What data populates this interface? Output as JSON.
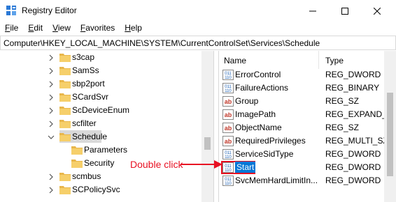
{
  "window": {
    "title": "Registry Editor",
    "minimize_symbol": "—",
    "maximize_symbol": "☐",
    "close_symbol": "✕"
  },
  "menu": [
    {
      "label": "File"
    },
    {
      "label": "Edit"
    },
    {
      "label": "View"
    },
    {
      "label": "Favorites"
    },
    {
      "label": "Help"
    }
  ],
  "address": {
    "path": "Computer\\HKEY_LOCAL_MACHINE\\SYSTEM\\CurrentControlSet\\Services\\Schedule"
  },
  "tree": {
    "items": [
      {
        "label": "s3cap",
        "expander": "collapsed",
        "level": 1
      },
      {
        "label": "SamSs",
        "expander": "collapsed",
        "level": 1
      },
      {
        "label": "sbp2port",
        "expander": "collapsed",
        "level": 1
      },
      {
        "label": "SCardSvr",
        "expander": "collapsed",
        "level": 1
      },
      {
        "label": "ScDeviceEnum",
        "expander": "collapsed",
        "level": 1
      },
      {
        "label": "scfilter",
        "expander": "collapsed",
        "level": 1
      },
      {
        "label": "Schedule",
        "expander": "expanded",
        "level": 1,
        "selected": true
      },
      {
        "label": "Parameters",
        "expander": "none",
        "level": 2
      },
      {
        "label": "Security",
        "expander": "none",
        "level": 2
      },
      {
        "label": "scmbus",
        "expander": "collapsed",
        "level": 1
      },
      {
        "label": "SCPolicySvc",
        "expander": "collapsed",
        "level": 1
      }
    ]
  },
  "list": {
    "header_name": "Name",
    "header_type": "Type",
    "rows": [
      {
        "name": "ErrorControl",
        "type": "REG_DWORD",
        "icon": "binary-value-icon"
      },
      {
        "name": "FailureActions",
        "type": "REG_BINARY",
        "icon": "binary-value-icon"
      },
      {
        "name": "Group",
        "type": "REG_SZ",
        "icon": "string-value-icon"
      },
      {
        "name": "ImagePath",
        "type": "REG_EXPAND_S",
        "icon": "string-value-icon"
      },
      {
        "name": "ObjectName",
        "type": "REG_SZ",
        "icon": "string-value-icon"
      },
      {
        "name": "RequiredPrivileges",
        "type": "REG_MULTI_SZ",
        "icon": "string-value-icon"
      },
      {
        "name": "ServiceSidType",
        "type": "REG_DWORD",
        "icon": "binary-value-icon"
      },
      {
        "name": "Start",
        "type": "REG_DWORD",
        "icon": "binary-value-icon",
        "selected": true
      },
      {
        "name": "SvcMemHardLimitIn...",
        "type": "REG_DWORD",
        "icon": "binary-value-icon"
      }
    ]
  },
  "annotation": {
    "text": "Double click"
  },
  "colors": {
    "selection": "#0078d7",
    "annotation": "#e81123",
    "folder": "#e8b64a"
  }
}
